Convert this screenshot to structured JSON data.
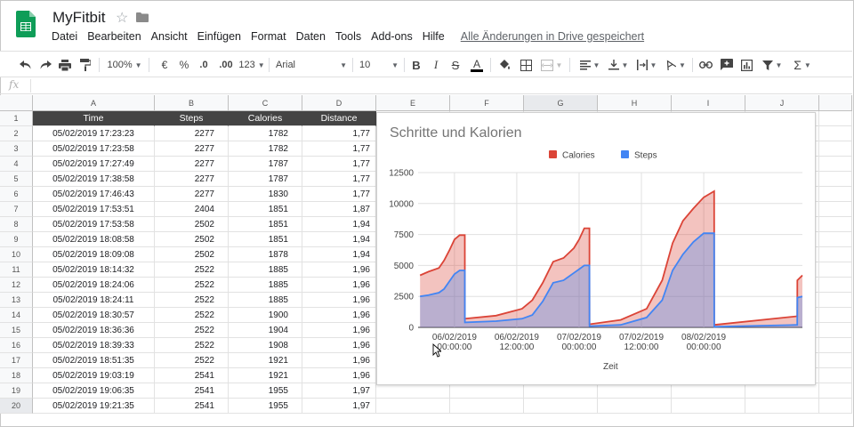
{
  "app": {
    "doc_title": "MyFitbit",
    "menu": [
      "Datei",
      "Bearbeiten",
      "Ansicht",
      "Einfügen",
      "Format",
      "Daten",
      "Tools",
      "Add-ons",
      "Hilfe"
    ],
    "save_status": "Alle Änderungen in Drive gespeichert"
  },
  "toolbar": {
    "zoom": "100%",
    "currency": "€",
    "percent": "%",
    "decimal_decrease": ".0",
    "decimal_increase": ".00",
    "number_format": "123",
    "font_family": "Arial",
    "font_size": "10"
  },
  "formula_bar": {
    "fx": "fx",
    "content": ""
  },
  "columns": [
    "A",
    "B",
    "C",
    "D",
    "E",
    "F",
    "G",
    "H",
    "I",
    "J"
  ],
  "selected_column": "G",
  "rows": [
    "1",
    "2",
    "3",
    "4",
    "5",
    "6",
    "7",
    "8",
    "9",
    "10",
    "11",
    "12",
    "13",
    "14",
    "15",
    "16",
    "17",
    "18",
    "19",
    "20"
  ],
  "selected_row": "20",
  "table": {
    "headers": [
      "Time",
      "Steps",
      "Calories",
      "Distance"
    ],
    "rows": [
      [
        "05/02/2019 17:23:23",
        "2277",
        "1782",
        "1,77"
      ],
      [
        "05/02/2019 17:23:58",
        "2277",
        "1782",
        "1,77"
      ],
      [
        "05/02/2019 17:27:49",
        "2277",
        "1787",
        "1,77"
      ],
      [
        "05/02/2019 17:38:58",
        "2277",
        "1787",
        "1,77"
      ],
      [
        "05/02/2019 17:46:43",
        "2277",
        "1830",
        "1,77"
      ],
      [
        "05/02/2019 17:53:51",
        "2404",
        "1851",
        "1,87"
      ],
      [
        "05/02/2019 17:53:58",
        "2502",
        "1851",
        "1,94"
      ],
      [
        "05/02/2019 18:08:58",
        "2502",
        "1851",
        "1,94"
      ],
      [
        "05/02/2019 18:09:08",
        "2502",
        "1878",
        "1,94"
      ],
      [
        "05/02/2019 18:14:32",
        "2522",
        "1885",
        "1,96"
      ],
      [
        "05/02/2019 18:24:06",
        "2522",
        "1885",
        "1,96"
      ],
      [
        "05/02/2019 18:24:11",
        "2522",
        "1885",
        "1,96"
      ],
      [
        "05/02/2019 18:30:57",
        "2522",
        "1900",
        "1,96"
      ],
      [
        "05/02/2019 18:36:36",
        "2522",
        "1904",
        "1,96"
      ],
      [
        "05/02/2019 18:39:33",
        "2522",
        "1908",
        "1,96"
      ],
      [
        "05/02/2019 18:51:35",
        "2522",
        "1921",
        "1,96"
      ],
      [
        "05/02/2019 19:03:19",
        "2541",
        "1921",
        "1,96"
      ],
      [
        "05/02/2019 19:06:35",
        "2541",
        "1955",
        "1,97"
      ],
      [
        "05/02/2019 19:21:35",
        "2541",
        "1955",
        "1,97"
      ]
    ]
  },
  "colors": {
    "header_fill": "#444444",
    "calories": "#db4437",
    "steps": "#4285f4",
    "sheets_green": "#0f9d58"
  },
  "chart_data": {
    "type": "area",
    "title": "Schritte und Kalorien",
    "xlabel": "Zeit",
    "ylabel": "",
    "ylim": [
      0,
      12500
    ],
    "yticks": [
      "0",
      "2500",
      "5000",
      "7500",
      "10000",
      "12500"
    ],
    "xticks": [
      {
        "date": "06/02/2019",
        "time": "00:00:00",
        "x": "2019-02-06 00:00"
      },
      {
        "date": "06/02/2019",
        "time": "12:00:00",
        "x": "2019-02-06 12:00"
      },
      {
        "date": "07/02/2019",
        "time": "00:00:00",
        "x": "2019-02-07 00:00"
      },
      {
        "date": "07/02/2019",
        "time": "12:00:00",
        "x": "2019-02-07 12:00"
      },
      {
        "date": "08/02/2019",
        "time": "00:00:00",
        "x": "2019-02-08 00:00"
      }
    ],
    "xlim": [
      "2019-02-05 17:00",
      "2019-02-08 19:00"
    ],
    "legend_position": "top",
    "grid": true,
    "series": [
      {
        "name": "Calories",
        "color": "#db4437",
        "points": [
          [
            "2019-02-05 17:23",
            4200
          ],
          [
            "2019-02-05 19:00",
            4500
          ],
          [
            "2019-02-05 21:00",
            4800
          ],
          [
            "2019-02-05 22:00",
            5400
          ],
          [
            "2019-02-05 23:00",
            6200
          ],
          [
            "2019-02-06 00:00",
            7100
          ],
          [
            "2019-02-06 01:00",
            7450
          ],
          [
            "2019-02-06 02:00",
            7450
          ],
          [
            "2019-02-06 02:01",
            700
          ],
          [
            "2019-02-06 08:00",
            950
          ],
          [
            "2019-02-06 13:00",
            1500
          ],
          [
            "2019-02-06 15:00",
            2200
          ],
          [
            "2019-02-06 17:00",
            3600
          ],
          [
            "2019-02-06 19:00",
            5300
          ],
          [
            "2019-02-06 21:00",
            5600
          ],
          [
            "2019-02-06 23:00",
            6400
          ],
          [
            "2019-02-07 00:00",
            7100
          ],
          [
            "2019-02-07 01:00",
            8000
          ],
          [
            "2019-02-07 02:00",
            8000
          ],
          [
            "2019-02-07 02:01",
            250
          ],
          [
            "2019-02-07 08:00",
            600
          ],
          [
            "2019-02-07 13:00",
            1500
          ],
          [
            "2019-02-07 16:00",
            3800
          ],
          [
            "2019-02-07 18:00",
            6800
          ],
          [
            "2019-02-07 20:00",
            8600
          ],
          [
            "2019-02-07 22:00",
            9600
          ],
          [
            "2019-02-08 00:00",
            10500
          ],
          [
            "2019-02-08 02:00",
            11000
          ],
          [
            "2019-02-08 02:01",
            200
          ],
          [
            "2019-02-08 18:00",
            900
          ],
          [
            "2019-02-08 18:01",
            3800
          ],
          [
            "2019-02-08 19:00",
            4200
          ]
        ]
      },
      {
        "name": "Steps",
        "color": "#4285f4",
        "points": [
          [
            "2019-02-05 17:23",
            2500
          ],
          [
            "2019-02-05 19:00",
            2600
          ],
          [
            "2019-02-05 21:00",
            2800
          ],
          [
            "2019-02-05 22:00",
            3100
          ],
          [
            "2019-02-05 23:00",
            3700
          ],
          [
            "2019-02-06 00:00",
            4300
          ],
          [
            "2019-02-06 01:00",
            4600
          ],
          [
            "2019-02-06 02:00",
            4600
          ],
          [
            "2019-02-06 02:01",
            400
          ],
          [
            "2019-02-06 08:00",
            500
          ],
          [
            "2019-02-06 13:00",
            700
          ],
          [
            "2019-02-06 15:00",
            1000
          ],
          [
            "2019-02-06 17:00",
            2100
          ],
          [
            "2019-02-06 19:00",
            3600
          ],
          [
            "2019-02-06 21:00",
            3800
          ],
          [
            "2019-02-06 23:00",
            4400
          ],
          [
            "2019-02-07 00:00",
            4700
          ],
          [
            "2019-02-07 01:00",
            5000
          ],
          [
            "2019-02-07 02:00",
            5000
          ],
          [
            "2019-02-07 02:01",
            100
          ],
          [
            "2019-02-07 08:00",
            200
          ],
          [
            "2019-02-07 13:00",
            800
          ],
          [
            "2019-02-07 16:00",
            2200
          ],
          [
            "2019-02-07 18:00",
            4600
          ],
          [
            "2019-02-07 20:00",
            5900
          ],
          [
            "2019-02-07 22:00",
            6900
          ],
          [
            "2019-02-08 00:00",
            7600
          ],
          [
            "2019-02-08 02:00",
            7600
          ],
          [
            "2019-02-08 02:01",
            50
          ],
          [
            "2019-02-08 18:00",
            200
          ],
          [
            "2019-02-08 18:01",
            2400
          ],
          [
            "2019-02-08 19:00",
            2500
          ]
        ]
      }
    ]
  }
}
